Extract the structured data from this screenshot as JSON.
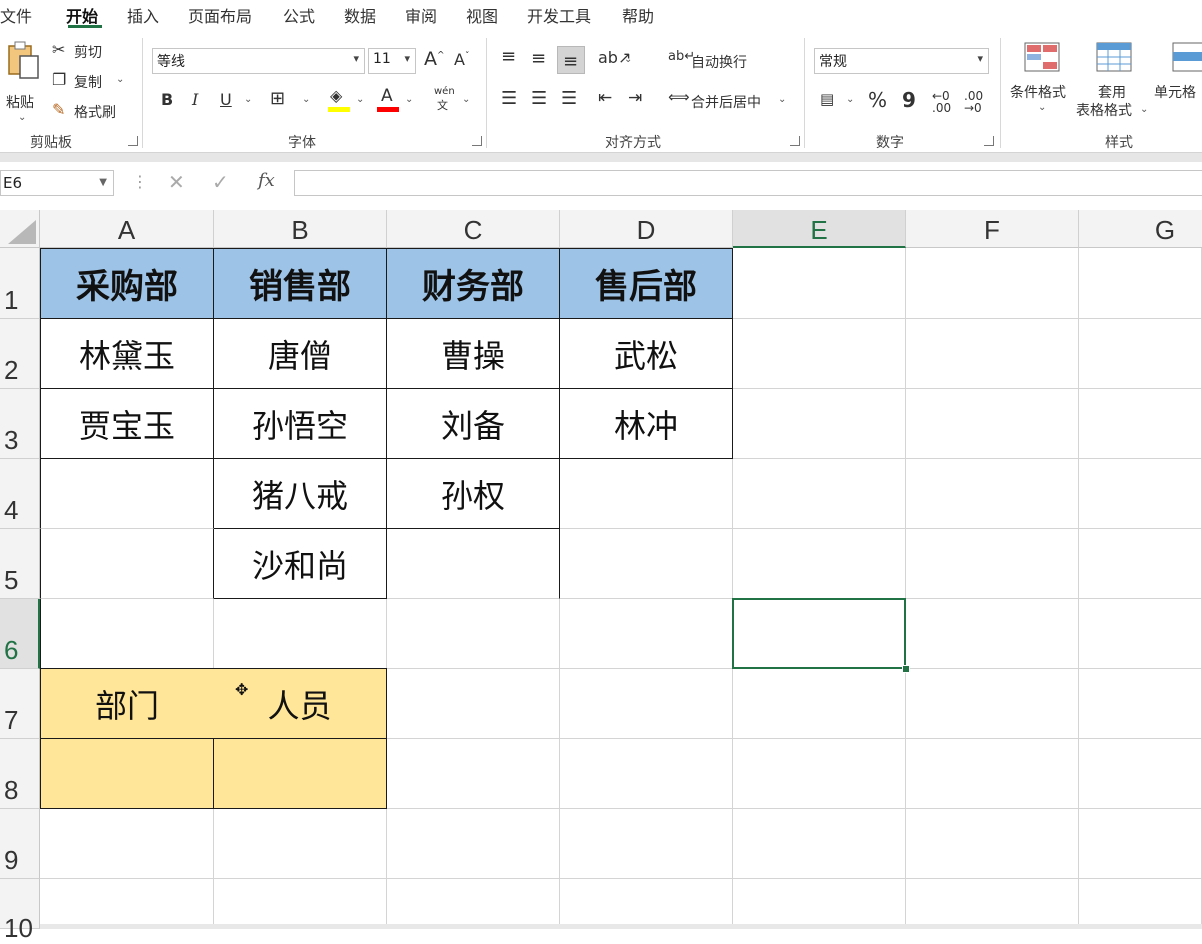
{
  "menu": {
    "items": [
      "文件",
      "开始",
      "插入",
      "页面布局",
      "公式",
      "数据",
      "审阅",
      "视图",
      "开发工具",
      "帮助"
    ],
    "active": "开始"
  },
  "ribbon": {
    "clipboard": {
      "paste": "粘贴",
      "cut": "剪切",
      "copy": "复制",
      "format_painter": "格式刷",
      "label": "剪贴板"
    },
    "font": {
      "name": "等线",
      "size": "11",
      "bold": "B",
      "italic": "I",
      "underline": "U",
      "increase_size": "A",
      "decrease_size": "A",
      "phonetic": "wén",
      "phonetic_char": "文",
      "label": "字体"
    },
    "alignment": {
      "wrap_text": "自动换行",
      "merge_center": "合并后居中",
      "label": "对齐方式"
    },
    "number": {
      "format": "常规",
      "percent": "%",
      "comma": "9",
      "label": "数字"
    },
    "styles": {
      "conditional": "条件格式",
      "table_format_line1": "套用",
      "table_format_line2": "表格格式",
      "cell_styles": "单元格",
      "label": "样式"
    }
  },
  "formula_bar": {
    "name_box": "E6",
    "fx": "fx",
    "value": ""
  },
  "columns": [
    "A",
    "B",
    "C",
    "D",
    "E",
    "F",
    "G"
  ],
  "rows": [
    "1",
    "2",
    "3",
    "4",
    "5",
    "6",
    "7",
    "8",
    "9",
    "10"
  ],
  "cells": {
    "A1": "采购部",
    "B1": "销售部",
    "C1": "财务部",
    "D1": "售后部",
    "A2": "林黛玉",
    "B2": "唐僧",
    "C2": "曹操",
    "D2": "武松",
    "A3": "贾宝玉",
    "B3": "孙悟空",
    "C3": "刘备",
    "D3": "林冲",
    "B4": "猪八戒",
    "C4": "孙权",
    "B5": "沙和尚",
    "A7": "部门",
    "B7": "人员"
  },
  "selected_cell": "E6",
  "colors": {
    "accent": "#217346",
    "header_fill": "#9dc3e6",
    "input_fill": "#ffe699"
  }
}
